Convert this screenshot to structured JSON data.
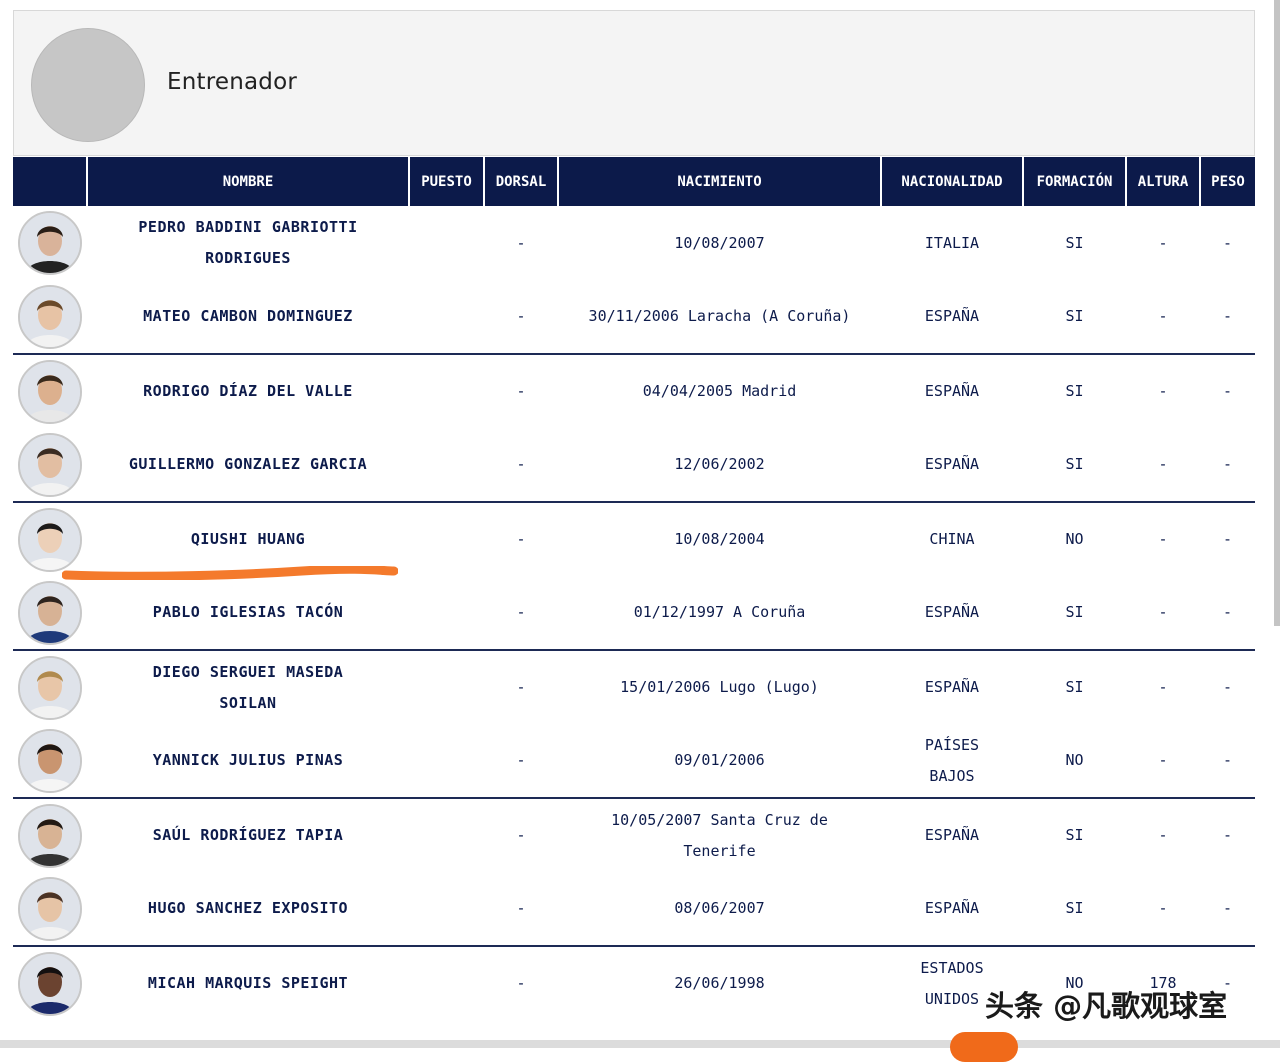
{
  "coach": {
    "title": "Entrenador"
  },
  "columns": [
    "",
    "NOMBRE",
    "PUESTO",
    "DORSAL",
    "NACIMIENTO",
    "NACIONALIDAD",
    "FORMACIÓN",
    "ALTURA",
    "PESO"
  ],
  "players": [
    {
      "nombre": "PEDRO BADDINI GABRIOTTI RODRIGUES",
      "puesto": "",
      "dorsal": "-",
      "nacimiento": "10/08/2007",
      "nacionalidad": "ITALIA",
      "formacion": "SI",
      "altura": "-",
      "peso": "-",
      "skin": "#d9b39a",
      "hair": "#2a1e16",
      "shirt": "#222222"
    },
    {
      "nombre": "MATEO CAMBON DOMINGUEZ",
      "puesto": "",
      "dorsal": "-",
      "nacimiento": "30/11/2006 Laracha (A Coruña)",
      "nacionalidad": "ESPAÑA",
      "formacion": "SI",
      "altura": "-",
      "peso": "-",
      "skin": "#e7c3a5",
      "hair": "#6b4a2a",
      "shirt": "#f2f2f2"
    },
    {
      "nombre": "RODRIGO DÍAZ DEL VALLE",
      "puesto": "",
      "dorsal": "-",
      "nacimiento": "04/04/2005 Madrid",
      "nacionalidad": "ESPAÑA",
      "formacion": "SI",
      "altura": "-",
      "peso": "-",
      "skin": "#dcb08e",
      "hair": "#3a2a1c",
      "shirt": "#e8e8e8"
    },
    {
      "nombre": "GUILLERMO GONZALEZ GARCIA",
      "puesto": "",
      "dorsal": "-",
      "nacimiento": "12/06/2002",
      "nacionalidad": "ESPAÑA",
      "formacion": "SI",
      "altura": "-",
      "peso": "-",
      "skin": "#e2bea2",
      "hair": "#3b2c22",
      "shirt": "#f2f2f2"
    },
    {
      "nombre": "QIUSHI HUANG",
      "puesto": "",
      "dorsal": "-",
      "nacimiento": "10/08/2004",
      "nacionalidad": "CHINA",
      "formacion": "NO",
      "altura": "-",
      "peso": "-",
      "skin": "#ecd0b8",
      "hair": "#1c1a1a",
      "shirt": "#f5f5f5"
    },
    {
      "nombre": "PABLO IGLESIAS TACÓN",
      "puesto": "",
      "dorsal": "-",
      "nacimiento": "01/12/1997 A Coruña",
      "nacionalidad": "ESPAÑA",
      "formacion": "SI",
      "altura": "-",
      "peso": "-",
      "skin": "#d7b295",
      "hair": "#2e241e",
      "shirt": "#1f3a7a"
    },
    {
      "nombre": "DIEGO SERGUEI MASEDA SOILAN",
      "puesto": "",
      "dorsal": "-",
      "nacimiento": "15/01/2006 Lugo (Lugo)",
      "nacionalidad": "ESPAÑA",
      "formacion": "SI",
      "altura": "-",
      "peso": "-",
      "skin": "#e8c6a8",
      "hair": "#b08a4e",
      "shirt": "#f2f2f2"
    },
    {
      "nombre": "YANNICK JULIUS PINAS",
      "puesto": "",
      "dorsal": "-",
      "nacimiento": "09/01/2006",
      "nacionalidad": "PAÍSES BAJOS",
      "formacion": "NO",
      "altura": "-",
      "peso": "-",
      "skin": "#c99570",
      "hair": "#1e1612",
      "shirt": "#f5f5f5"
    },
    {
      "nombre": "SAÚL RODRÍGUEZ TAPIA",
      "puesto": "",
      "dorsal": "-",
      "nacimiento": "10/05/2007 Santa Cruz de Tenerife",
      "nacionalidad": "ESPAÑA",
      "formacion": "SI",
      "altura": "-",
      "peso": "-",
      "skin": "#d8b394",
      "hair": "#231a14",
      "shirt": "#333333"
    },
    {
      "nombre": "HUGO SANCHEZ EXPOSITO",
      "puesto": "",
      "dorsal": "-",
      "nacimiento": "08/06/2007",
      "nacionalidad": "ESPAÑA",
      "formacion": "SI",
      "altura": "-",
      "peso": "-",
      "skin": "#e6c4a6",
      "hair": "#4a3224",
      "shirt": "#f2f2f2"
    },
    {
      "nombre": "MICAH MARQUIS SPEIGHT",
      "puesto": "",
      "dorsal": "-",
      "nacimiento": "26/06/1998",
      "nacionalidad": "ESTADOS UNIDOS",
      "formacion": "NO",
      "altura": "178",
      "peso": "-",
      "skin": "#6b4330",
      "hair": "#141010",
      "shirt": "#1b2a6b"
    }
  ],
  "watermark": "头条 @凡歌观球室",
  "annotation": {
    "color": "#f47a2c"
  }
}
